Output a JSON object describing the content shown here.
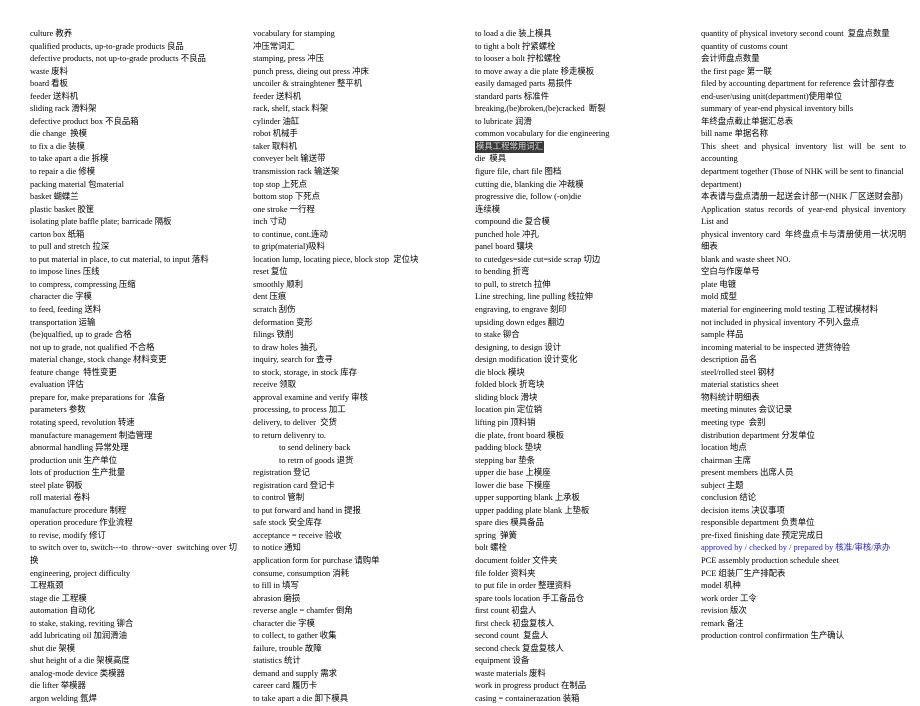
{
  "document": {
    "title": "Stamping and Die Engineering English-Chinese Glossary",
    "page_background": "#ffffff",
    "text_color": "#000000",
    "selection_background": "#3a3a3a",
    "selection_text_color": "#d8d8d8",
    "link_color": "#2222cc",
    "column_count": 4
  },
  "columns": [
    {
      "id": "column-1",
      "entries": [
        {
          "text": "culture 教养"
        },
        {
          "text": "qualified products, up-to-grade products 良品"
        },
        {
          "text": "defective products, not up-to-grade products 不良品"
        },
        {
          "text": "waste 废料"
        },
        {
          "text": "board 看板"
        },
        {
          "text": "feeder 送料机"
        },
        {
          "text": "sliding rack 滑料架"
        },
        {
          "text": "defective product box 不良品箱"
        },
        {
          "text": "die change  换模"
        },
        {
          "text": "to fix a die 装模"
        },
        {
          "text": "to take apart a die 拆模"
        },
        {
          "text": "to repair a die 修模"
        },
        {
          "text": "packing material 包material"
        },
        {
          "text": "basket 蝴蝶兰"
        },
        {
          "text": "plastic basket 胶筐"
        },
        {
          "text": "isolating plate baffle plate; barricade 隔板"
        },
        {
          "text": "carton box 纸箱"
        },
        {
          "text": "to pull and stretch 拉深"
        },
        {
          "text": "to put material in place, to cut material, to input 落料"
        },
        {
          "text": "to impose lines 压线"
        },
        {
          "text": "to compress, compressing 压缩"
        },
        {
          "text": "character die 字模"
        },
        {
          "text": "to feed, feeding 送料"
        },
        {
          "text": "transportation 运输"
        },
        {
          "text": "(be)qualfied, up to grade 合格"
        },
        {
          "text": "not up to grade, not qualified 不合格"
        },
        {
          "text": "material change, stock change 材料变更"
        },
        {
          "text": "feature change  特性变更"
        },
        {
          "text": "evaluation 评估"
        },
        {
          "text": "prepare for, make preparations for  准备"
        },
        {
          "text": "parameters 参数"
        },
        {
          "text": "rotating speed, revolution 转速"
        },
        {
          "text": "manufacture management 制造管理"
        },
        {
          "text": "abnormal handling 异常处理"
        },
        {
          "text": "production unit 生产单位"
        },
        {
          "text": "lots of production 生产批量"
        },
        {
          "text": "steel plate 钢板"
        },
        {
          "text": "roll material 卷料"
        },
        {
          "text": "manufacture procedure 制程"
        },
        {
          "text": "operation procedure 作业流程"
        },
        {
          "text": "to revise, modify 修订"
        },
        {
          "text": "to switch over to, switch---to  throw--over  switching over 切换",
          "justified": true
        },
        {
          "text": "engineering, project difficulty"
        },
        {
          "text": "工程瓶颈"
        },
        {
          "text": "stage die 工程模"
        },
        {
          "text": "automation 自动化"
        },
        {
          "text": "to stake, staking, reviting 铆合"
        },
        {
          "text": "add lubricating oil 加润滑油"
        },
        {
          "text": "shut die 架模"
        },
        {
          "text": "shut height of a die 架模高度"
        },
        {
          "text": "analog-mode device 类模器"
        },
        {
          "text": "die lifter 举模器"
        },
        {
          "text": "argon welding 氩焊"
        }
      ]
    },
    {
      "id": "column-2",
      "entries": [
        {
          "text": "vocabulary for stamping"
        },
        {
          "text": "冲压常词汇"
        },
        {
          "text": "stamping, press 冲压"
        },
        {
          "text": "punch press, dieing out press 冲床"
        },
        {
          "text": "uncoiler & strainghtener 整平机"
        },
        {
          "text": "feeder 送料机"
        },
        {
          "text": "rack, shelf, stack 料架"
        },
        {
          "text": "cylinder 油缸"
        },
        {
          "text": "robot 机械手"
        },
        {
          "text": "taker 取料机"
        },
        {
          "text": "conveyer belt 输送带"
        },
        {
          "text": "transmission rack 输送架"
        },
        {
          "text": "top stop 上死点"
        },
        {
          "text": "bottom stop 下死点"
        },
        {
          "text": "one stroke 一行程"
        },
        {
          "text": "inch 寸动"
        },
        {
          "text": "to continue, cont.连动"
        },
        {
          "text": "to grip(material)吸料"
        },
        {
          "text": "location lump, locating piece, block stop  定位块"
        },
        {
          "text": "reset 复位"
        },
        {
          "text": "smoothly 顺利"
        },
        {
          "text": "dent 压痕"
        },
        {
          "text": "scratch 刮伤"
        },
        {
          "text": "deformation 变形"
        },
        {
          "text": "filings 铁削"
        },
        {
          "text": "to draw holes 抽孔"
        },
        {
          "text": "inquiry, search for 查寻"
        },
        {
          "text": "to stock, storage, in stock 库存"
        },
        {
          "text": "receive 领取"
        },
        {
          "text": "approval examine and verify 审核"
        },
        {
          "text": "processing, to process 加工"
        },
        {
          "text": "delivery, to deliver  交货"
        },
        {
          "text": "to return delivenry to."
        },
        {
          "text": "to send delinery back",
          "indent": true
        },
        {
          "text": "to retrn of goods 退货",
          "indent": true
        },
        {
          "text": "registration 登记"
        },
        {
          "text": "registration card 登记卡"
        },
        {
          "text": "to control 管制"
        },
        {
          "text": "to put forward and hand in 提报"
        },
        {
          "text": "safe stock 安全库存"
        },
        {
          "text": "acceptance = receive 验收"
        },
        {
          "text": "to notice 通知"
        },
        {
          "text": "application form for purchase 请购单"
        },
        {
          "text": "consume, consumption 消耗"
        },
        {
          "text": "to fill in 填写"
        },
        {
          "text": "abrasion 磨损"
        },
        {
          "text": "reverse angle = chamfer 倒角"
        },
        {
          "text": "character die 字模"
        },
        {
          "text": "to collect, to gather 收集"
        },
        {
          "text": "failure, trouble 故障"
        },
        {
          "text": "statistics 统计"
        },
        {
          "text": "demand and supply 需求"
        },
        {
          "text": "career card 履历卡"
        },
        {
          "text": "to take apart a die 卸下模具"
        }
      ]
    },
    {
      "id": "column-3",
      "entries": [
        {
          "text": "to load a die 装上模具"
        },
        {
          "text": "to tight a bolt 拧紧螺栓"
        },
        {
          "text": "to looser a bolt 拧松螺栓"
        },
        {
          "text": "to move away a die plate 移走模板"
        },
        {
          "text": "easily damaged parts 易损件"
        },
        {
          "text": "standard parts 标准件"
        },
        {
          "text": "breaking,(be)broken,(be)cracked  断裂"
        },
        {
          "text": "to lubricate 润滑"
        },
        {
          "text": "common vocabulary for die engineering"
        },
        {
          "text": "模具工程常用词汇",
          "selected": true
        },
        {
          "text": "die  模具"
        },
        {
          "text": "figure file, chart file 图档"
        },
        {
          "text": "cutting die, blanking die 冲裁模"
        },
        {
          "text": "progressive die, follow (-on)die"
        },
        {
          "text": "连续模"
        },
        {
          "text": "compound die 复合模"
        },
        {
          "text": "punched hole 冲孔"
        },
        {
          "text": "panel board 镶块"
        },
        {
          "text": "to cutedges=side cut=side scrap 切边"
        },
        {
          "text": "to bending 折弯"
        },
        {
          "text": "to pull, to stretch 拉伸"
        },
        {
          "text": "Line streching, line pulling 线拉伸"
        },
        {
          "text": "engraving, to engrave 刻印"
        },
        {
          "text": "upsiding down edges 翻边"
        },
        {
          "text": "to stake 铆合"
        },
        {
          "text": "designing, to design 设计"
        },
        {
          "text": "design modification 设计变化"
        },
        {
          "text": "die block 模块"
        },
        {
          "text": "folded block 折弯块"
        },
        {
          "text": "sliding block 滑块"
        },
        {
          "text": "location pin 定位销"
        },
        {
          "text": "lifting pin 顶料销"
        },
        {
          "text": "die plate, front board 模板"
        },
        {
          "text": "padding block 垫块"
        },
        {
          "text": "stepping bar 垫条"
        },
        {
          "text": "upper die base 上模座"
        },
        {
          "text": "lower die base 下模座"
        },
        {
          "text": "upper supporting blank 上承板"
        },
        {
          "text": "upper padding plate blank 上垫板"
        },
        {
          "text": "spare dies 模具备品"
        },
        {
          "text": "spring  弹簧"
        },
        {
          "text": "bolt 螺栓"
        },
        {
          "text": "document folder 文件夹"
        },
        {
          "text": "file folder 资料夹"
        },
        {
          "text": "to put file in order 整理资料"
        },
        {
          "text": "spare tools location 手工备品仓"
        },
        {
          "text": "first count 初盘人"
        },
        {
          "text": "first check 初盘复核人"
        },
        {
          "text": "second count  复盘人"
        },
        {
          "text": "second check 复盘复核人"
        },
        {
          "text": "equipment 设备"
        },
        {
          "text": "waste materials 废料"
        },
        {
          "text": "work in progress product 在制品"
        },
        {
          "text": "casing = containerazation 装箱"
        }
      ]
    },
    {
      "id": "column-4",
      "entries": [
        {
          "text": "quantity of physical invetory second count  复盘点数量",
          "justified": true
        },
        {
          "text": "quantity of customs count"
        },
        {
          "text": "会计师盘点数量"
        },
        {
          "text": "the first page 第一联"
        },
        {
          "text": "filed by accounting department for reference 会计部存查",
          "justified": true
        },
        {
          "text": "end-user/using unit(department)使用单位"
        },
        {
          "text": "summary of year-end physical inventory bills"
        },
        {
          "text": "年终盘点截止单据汇总表"
        },
        {
          "text": "bill name 单据名称"
        },
        {
          "text": "This sheet and physical inventory list will be sent to accounting",
          "justified": true
        },
        {
          "text": "department together (Those of NHK will be sent to financial",
          "justified": true
        },
        {
          "text": "department)"
        },
        {
          "text": "本表请与盘点清册一起送会计部一(NHK 厂区送财会部)",
          "justified": true
        },
        {
          "text": "Application status records of year-end physical inventory List and",
          "justified": true
        },
        {
          "text": "physical inventory card  年终盘点卡与清册使用一状况明细表",
          "justified": true
        },
        {
          "text": "blank and waste sheet NO."
        },
        {
          "text": "空白与作废单号"
        },
        {
          "text": "plate 电镀"
        },
        {
          "text": "mold 成型"
        },
        {
          "text": "material for engineering mold testing 工程试模材料"
        },
        {
          "text": "not included in physical inventory 不列入盘点"
        },
        {
          "text": "sample 样品"
        },
        {
          "text": "incoming material to be inspected 进货待验"
        },
        {
          "text": "description 品名"
        },
        {
          "text": "steel/rolled steel 钢材"
        },
        {
          "text": "material statistics sheet"
        },
        {
          "text": "物料统计明细表"
        },
        {
          "text": "meeting minutes 会议记录"
        },
        {
          "text": "meeting type  会别"
        },
        {
          "text": "distribution department 分发单位"
        },
        {
          "text": "location 地点"
        },
        {
          "text": "chairman 主席"
        },
        {
          "text": "present members 出席人员"
        },
        {
          "text": "subject 主题"
        },
        {
          "text": "conclusion 结论"
        },
        {
          "text": "decision items 决议事项"
        },
        {
          "text": "responsible department 负责单位"
        },
        {
          "text": "pre-fixed finishing date 预定完成日"
        },
        {
          "text": "approved by / checked by / prepared by 核准/审核/承办",
          "blue": true,
          "justified": true
        },
        {
          "text": "PCE assembly production schedule sheet"
        },
        {
          "text": "PCE 组装厂生产排配表"
        },
        {
          "text": "model 机种"
        },
        {
          "text": "work order 工令"
        },
        {
          "text": "revision 版次"
        },
        {
          "text": "remark 备注"
        },
        {
          "text": "production control confirmation 生产确认"
        }
      ]
    }
  ]
}
